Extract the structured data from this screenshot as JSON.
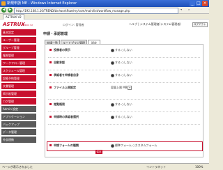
{
  "window": {
    "title": "新規申請 ME - Windows Internet Explorer"
  },
  "address": {
    "url": "http://192.168.1.10/TREND/bin/workflow/my/com/main/list/workflow_manage.php"
  },
  "favorites": {
    "tab": "ASTRUX V2"
  },
  "header": {
    "logo": "ASTRUX",
    "logo_sub": "ASTRUX V2",
    "user": "ログイン: 管理者",
    "links": "ヘルプ | システム管理者(システム管理者)",
    "logout": "ログアウト"
  },
  "sidebar": {
    "items": [
      "基本設定",
      "ユーザー管理",
      "グループ管理",
      "権限管理",
      "ワークフロー管理",
      "スケジュール管理",
      "設備予約管理",
      "文書管理",
      "掲示板管理",
      "ログ管理",
      "Admin 設定",
      "アプリケーション",
      "バックアップ",
      "データ管理",
      "外部連携"
    ]
  },
  "main": {
    "title": "申請・承認管理",
    "tabs": [
      "申請一覧",
      "ルートプラン管理",
      "設定"
    ],
    "rows": [
      {
        "label": "投稿者の表示",
        "value": "する ○しない"
      },
      {
        "label": "自動承認",
        "value": "する ○しない"
      },
      {
        "label": "承認者を申請者自身",
        "value": "する ○しない"
      },
      {
        "label": "ファイル上限設定",
        "value": "容量上限 MB"
      },
      {
        "label": "閲覧権限",
        "value": "する ○しない"
      },
      {
        "label": "申請時の承認者選択",
        "value": "する ○しない"
      },
      {
        "label": "申請フォームの種類",
        "value": "標準フォーム ○カスタムフォーム"
      }
    ],
    "save": "保存"
  },
  "statusbar": {
    "text": "ページが表示されました",
    "zone": "イントラネット",
    "zoom": "100%"
  }
}
